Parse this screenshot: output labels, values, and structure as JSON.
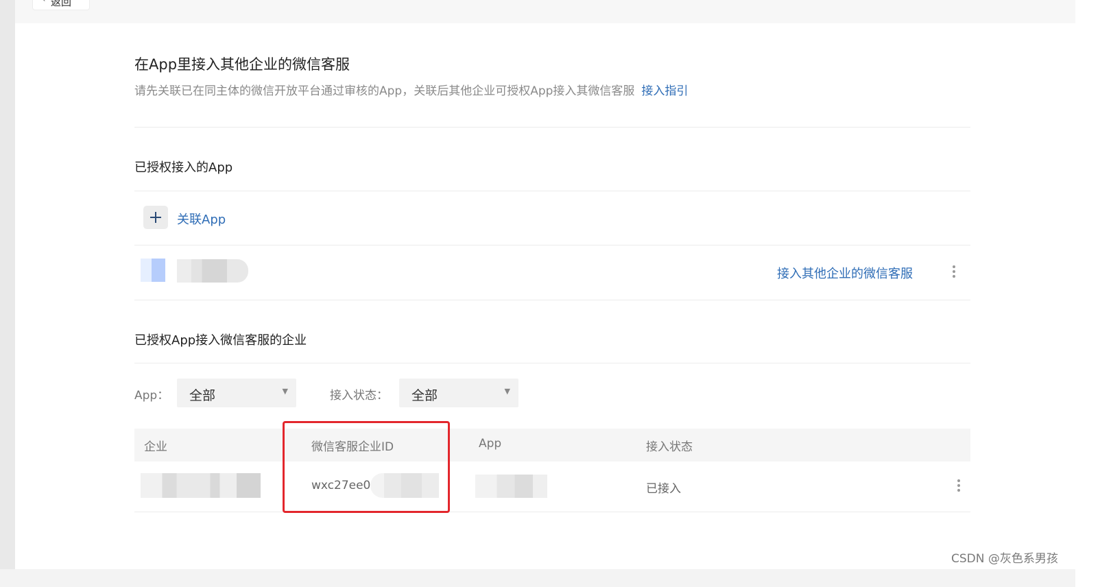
{
  "topbar": {
    "back_label": "返回"
  },
  "header": {
    "title": "在App里接入其他企业的微信客服",
    "description": "请先关联已在同主体的微信开放平台通过审核的App，关联后其他企业可授权App接入其微信客服",
    "guide_link": "接入指引"
  },
  "authorized_apps": {
    "title": "已授权接入的App",
    "add_label": "关联App",
    "rows": [
      {
        "action_link": "接入其他企业的微信客服"
      }
    ]
  },
  "enterprises": {
    "title": "已授权App接入微信客服的企业",
    "filters": {
      "app_label": "App：",
      "app_value": "全部",
      "status_label": "接入状态：",
      "status_value": "全部"
    },
    "columns": [
      "企业",
      "微信客服企业ID",
      "App",
      "接入状态"
    ],
    "rows": [
      {
        "corp_id": "wxc27ee0",
        "status": "已接入"
      }
    ]
  },
  "watermark": "CSDN @灰色系男孩",
  "colors": {
    "link": "#2f6db6",
    "highlight_box": "#e3262c"
  }
}
